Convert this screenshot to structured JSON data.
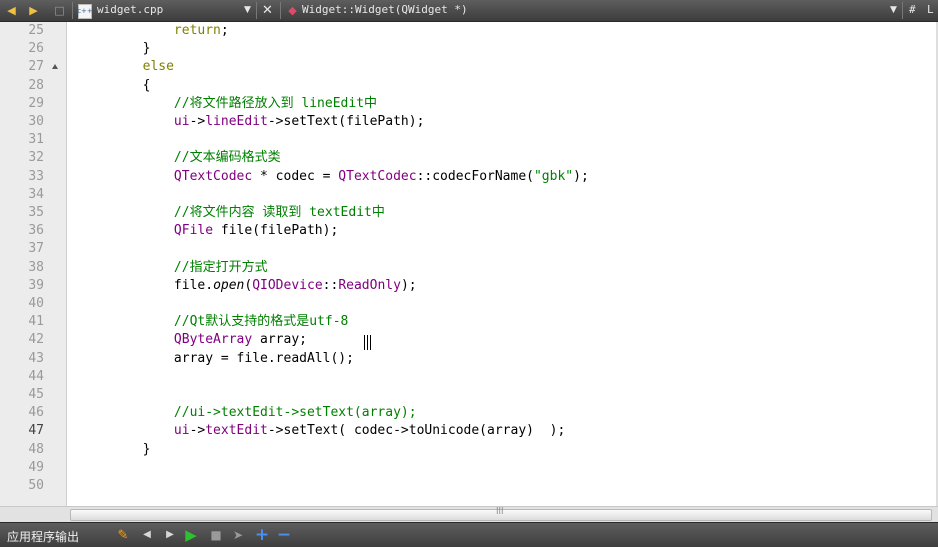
{
  "colors": {
    "keyword": "#808000",
    "comment": "#008000",
    "type": "#800080",
    "string": "#008000",
    "plain": "#000000",
    "line_number": "#9a9a9a",
    "gutter_bg": "#ececec",
    "toolbar_bg": "#4a4a4a"
  },
  "toolbar": {
    "back_icon": "arrow-left-icon",
    "forward_icon": "arrow-right-icon",
    "lock_icon": "lock-icon",
    "file_type_icon": "cpp-file-icon",
    "file_name": "widget.cpp",
    "close_icon": "close-icon",
    "symbol_icon": "function-icon",
    "symbol_name": "Widget::Widget(QWidget *)",
    "hash": "#",
    "line_label": "L"
  },
  "editor": {
    "lines": [
      {
        "n": "25",
        "segments": [
          {
            "t": "            ",
            "c": ""
          },
          {
            "t": "return",
            "c": "kw"
          },
          {
            "t": ";",
            "c": ""
          }
        ]
      },
      {
        "n": "26",
        "segments": [
          {
            "t": "        }",
            "c": ""
          }
        ]
      },
      {
        "n": "27",
        "segments": [
          {
            "t": "        ",
            "c": ""
          },
          {
            "t": "else",
            "c": "kw"
          }
        ]
      },
      {
        "n": "28",
        "segments": [
          {
            "t": "        {",
            "c": ""
          }
        ]
      },
      {
        "n": "29",
        "segments": [
          {
            "t": "            ",
            "c": ""
          },
          {
            "t": "//将文件路径放入到 lineEdit中",
            "c": "cm"
          }
        ]
      },
      {
        "n": "30",
        "segments": [
          {
            "t": "            ",
            "c": ""
          },
          {
            "t": "ui",
            "c": "ty"
          },
          {
            "t": "->",
            "c": ""
          },
          {
            "t": "lineEdit",
            "c": "ty"
          },
          {
            "t": "->setText(filePath);",
            "c": ""
          }
        ]
      },
      {
        "n": "31",
        "segments": []
      },
      {
        "n": "32",
        "segments": [
          {
            "t": "            ",
            "c": ""
          },
          {
            "t": "//文本编码格式类",
            "c": "cm"
          }
        ]
      },
      {
        "n": "33",
        "segments": [
          {
            "t": "            ",
            "c": ""
          },
          {
            "t": "QTextCodec",
            "c": "ty"
          },
          {
            "t": " * codec = ",
            "c": ""
          },
          {
            "t": "QTextCodec",
            "c": "ty"
          },
          {
            "t": "::codecForName(",
            "c": ""
          },
          {
            "t": "\"gbk\"",
            "c": "st"
          },
          {
            "t": ");",
            "c": ""
          }
        ]
      },
      {
        "n": "34",
        "segments": []
      },
      {
        "n": "35",
        "segments": [
          {
            "t": "            ",
            "c": ""
          },
          {
            "t": "//将文件内容 读取到 textEdit中",
            "c": "cm"
          }
        ]
      },
      {
        "n": "36",
        "segments": [
          {
            "t": "            ",
            "c": ""
          },
          {
            "t": "QFile",
            "c": "ty"
          },
          {
            "t": " file(filePath);",
            "c": ""
          }
        ]
      },
      {
        "n": "37",
        "segments": []
      },
      {
        "n": "38",
        "segments": [
          {
            "t": "            ",
            "c": ""
          },
          {
            "t": "//指定打开方式",
            "c": "cm"
          }
        ]
      },
      {
        "n": "39",
        "segments": [
          {
            "t": "            ",
            "c": ""
          },
          {
            "t": "file.",
            "c": ""
          },
          {
            "t": "open",
            "c": "it"
          },
          {
            "t": "(",
            "c": ""
          },
          {
            "t": "QIODevice",
            "c": "ty"
          },
          {
            "t": "::",
            "c": ""
          },
          {
            "t": "ReadOnly",
            "c": "ty"
          },
          {
            "t": ");",
            "c": ""
          }
        ]
      },
      {
        "n": "40",
        "segments": []
      },
      {
        "n": "41",
        "segments": [
          {
            "t": "            ",
            "c": ""
          },
          {
            "t": "//Qt默认支持的格式是utf-8",
            "c": "cm"
          }
        ]
      },
      {
        "n": "42",
        "segments": [
          {
            "t": "            ",
            "c": ""
          },
          {
            "t": "QByteArray",
            "c": "ty"
          },
          {
            "t": " array;",
            "c": ""
          }
        ]
      },
      {
        "n": "43",
        "segments": [
          {
            "t": "            ",
            "c": ""
          },
          {
            "t": "array = file.readAll();",
            "c": ""
          }
        ]
      },
      {
        "n": "44",
        "segments": []
      },
      {
        "n": "45",
        "segments": []
      },
      {
        "n": "46",
        "segments": [
          {
            "t": "            ",
            "c": ""
          },
          {
            "t": "//ui->textEdit->setText(array);",
            "c": "cm"
          }
        ]
      },
      {
        "n": "47",
        "segments": [
          {
            "t": "            ",
            "c": ""
          },
          {
            "t": "ui",
            "c": "ty"
          },
          {
            "t": "->",
            "c": ""
          },
          {
            "t": "textEdit",
            "c": "ty"
          },
          {
            "t": "->setText( codec->toUnicode(array)  );",
            "c": ""
          }
        ]
      },
      {
        "n": "48",
        "segments": [
          {
            "t": "        }",
            "c": ""
          }
        ]
      },
      {
        "n": "49",
        "segments": []
      },
      {
        "n": "50",
        "segments": []
      }
    ],
    "current_line": "47",
    "fold_line": "27"
  },
  "bottom_panel": {
    "title": "应用程序输出",
    "icons": [
      "clear-output-icon",
      "previous-item-icon",
      "next-item-icon",
      "run-icon",
      "stop-icon",
      "debug-icon",
      "zoom-in-icon",
      "zoom-out-icon"
    ]
  },
  "scrollbar": {
    "grip": "lll"
  }
}
